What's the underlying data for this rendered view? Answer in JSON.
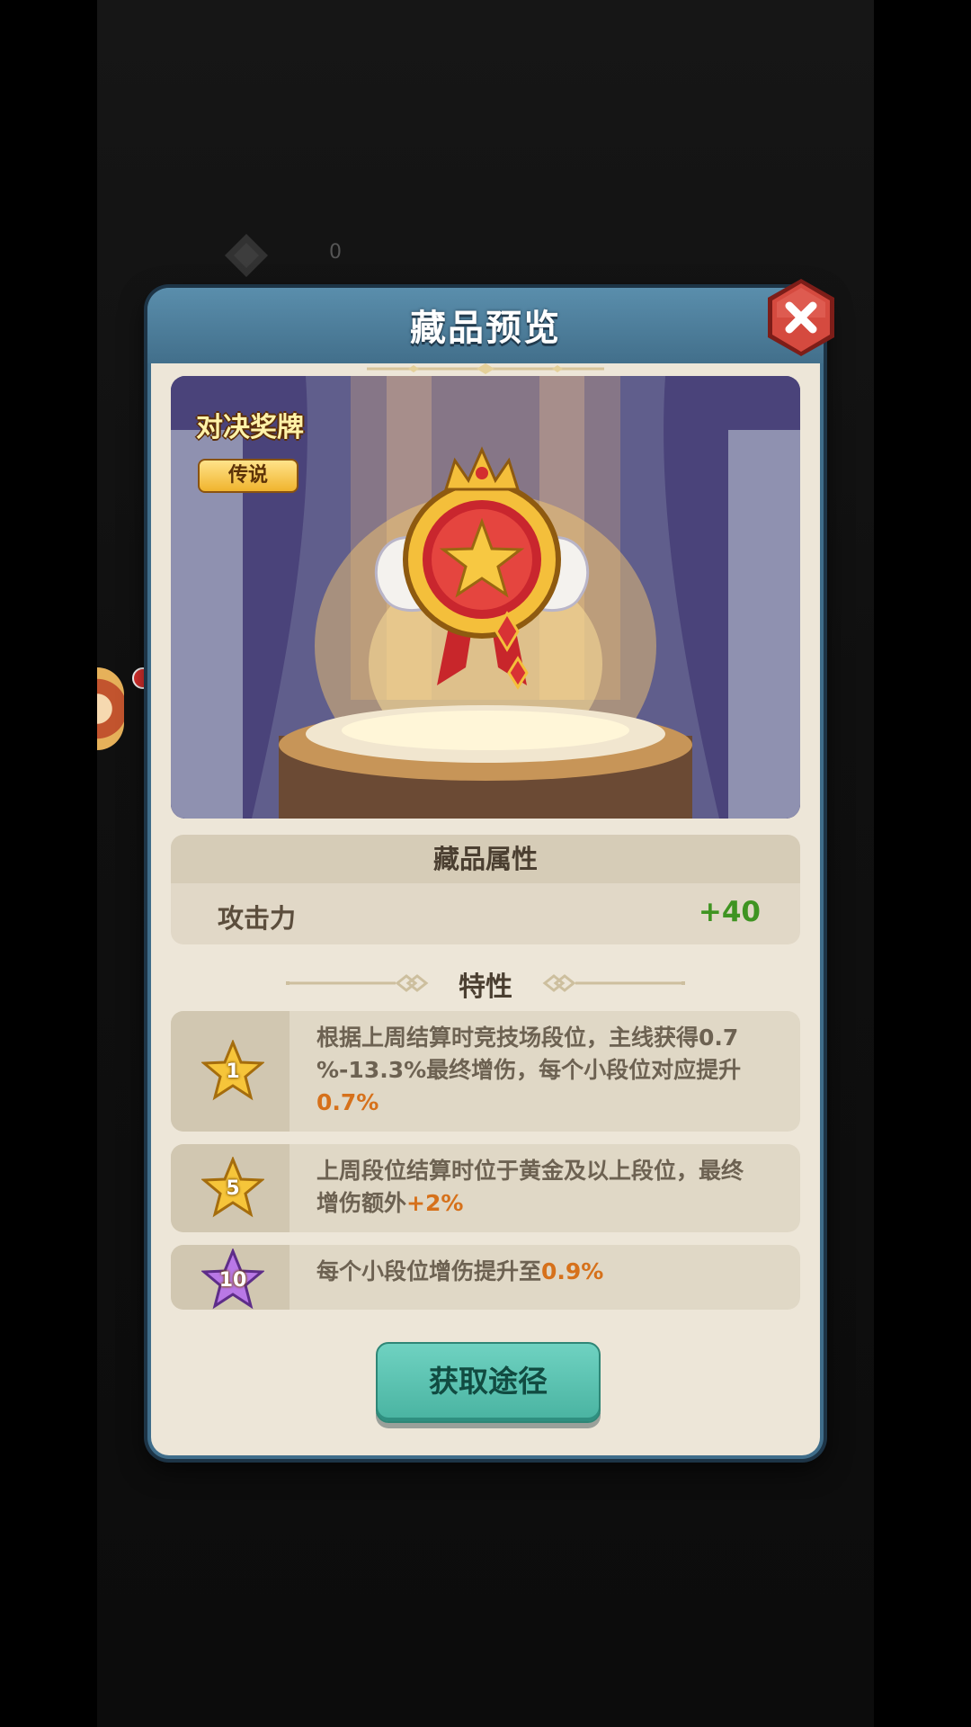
{
  "background": {
    "counter_text": "0"
  },
  "dialog": {
    "title": "藏品预览",
    "close_icon": "close-x-icon"
  },
  "item": {
    "name": "对决奖牌",
    "rarity": "传说",
    "image_icon": "winged-gold-star-medal"
  },
  "attributes": {
    "header": "藏品属性",
    "rows": [
      {
        "name": "攻击力",
        "value": "+40"
      }
    ]
  },
  "traits": {
    "header": "特性",
    "items": [
      {
        "star_level": "1",
        "star_color": "#f6c53a",
        "text_lines": [
          "根据上周结算时竞技场段位，主线获得0.7",
          "%-13.3%最终增伤，每个小段位对应提升"
        ],
        "highlight": "0.7%"
      },
      {
        "star_level": "5",
        "star_color": "#f6c53a",
        "text": "上周段位结算时位于黄金及以上段位，最终",
        "text2": "增伤额外",
        "highlight": "+2%"
      },
      {
        "star_level": "10",
        "star_color": "#b978e6",
        "text": "每个小段位增伤提升至",
        "highlight": "0.9%"
      }
    ]
  },
  "obtain_button": {
    "label": "获取途径"
  },
  "colors": {
    "accent_orange": "#d6711b",
    "attr_green": "#3f9422",
    "button_teal": "#49b3a1",
    "header_blue": "#426f8b"
  }
}
